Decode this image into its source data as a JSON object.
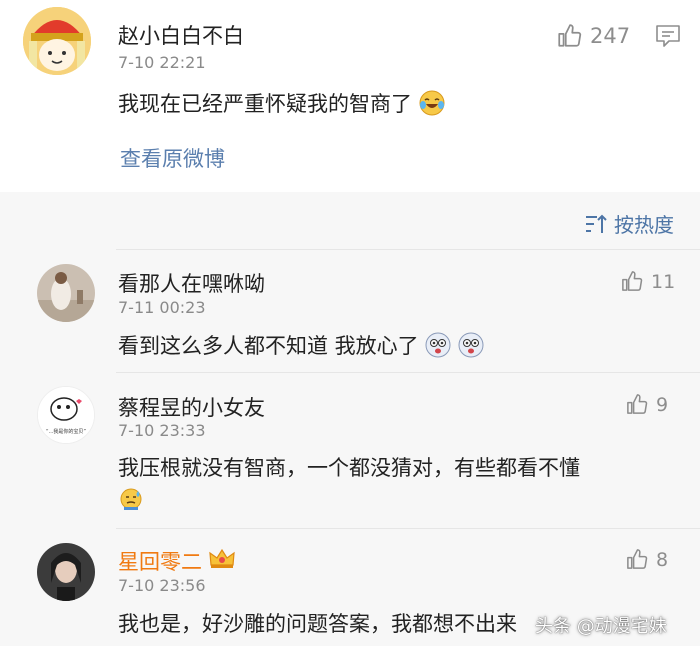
{
  "post": {
    "author": "赵小白白不白",
    "time": "7-10 22:21",
    "text": "我现在已经严重怀疑我的智商了",
    "like_count": "247",
    "view_original": "查看原微博"
  },
  "sort": {
    "label": "按热度"
  },
  "comments": [
    {
      "author": "看那人在嘿咻呦",
      "time": "7-11 00:23",
      "text": "看到这么多人都不知道 我放心了",
      "like_count": "11"
    },
    {
      "author": "蔡程昱的小女友",
      "time": "7-10 23:33",
      "text": "我压根就没有智商，一个都没猜对，有些都看不懂",
      "like_count": "9",
      "avatar_caption": "“...我是你的宝贝”"
    },
    {
      "author": "星回零二",
      "time": "7-10 23:56",
      "text": "我也是，好沙雕的问题答案，我都想不出来",
      "like_count": "8"
    }
  ],
  "watermark": "头条 @动漫宅妹",
  "colors": {
    "link": "#5b7fae",
    "vip_name": "#f07a12",
    "meta": "#8a8a8a",
    "background_lower": "#f7f7f7"
  },
  "icons": [
    "thumbs-up-icon",
    "comment-icon",
    "sort-icon",
    "laugh-cry-emoji",
    "scared-emoji",
    "sweat-emoji",
    "vip-crown-icon"
  ]
}
